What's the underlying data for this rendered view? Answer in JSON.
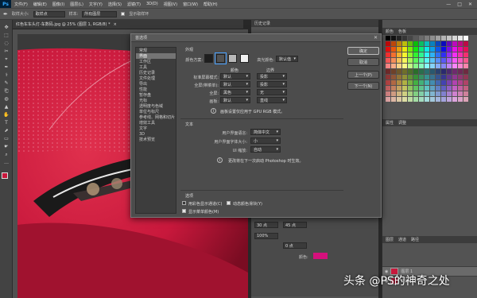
{
  "app": {
    "logo": "Ps",
    "menus": [
      "文件(F)",
      "编辑(E)",
      "图像(I)",
      "图层(L)",
      "文字(Y)",
      "选择(S)",
      "滤镜(T)",
      "3D(D)",
      "视图(V)",
      "窗口(W)",
      "帮助(H)"
    ],
    "win_min": "—",
    "win_max": "□",
    "win_close": "✕"
  },
  "options": {
    "field1_label": "取样大小:",
    "field1_value": "取样点",
    "field2_label": "样本:",
    "field2_value": "所有图层",
    "show_ring": "显示取样环"
  },
  "document": {
    "tab": "红色车车头灯-车数码.jpg @ 25% (图层 1, RGB/8) *",
    "close": "×"
  },
  "panels": {
    "right_tabs": [
      "颜色",
      "色板"
    ],
    "history_tab": "历史记录",
    "props_tabs": [
      "属性",
      "调整"
    ],
    "layer_tabs": [
      "图层",
      "通道",
      "路径"
    ],
    "layers": [
      {
        "name": "图层 1"
      },
      {
        "name": "背景"
      }
    ],
    "mid_numbers": [
      "30 点",
      "45 点",
      "100%",
      "0 点"
    ],
    "mid_color_label": "颜色:"
  },
  "dialog": {
    "title": "首选项",
    "close": "✕",
    "sidebar": [
      "常规",
      "界面",
      "工作区",
      "工具",
      "历史记录",
      "文件处理",
      "导出",
      "性能",
      "暂存盘",
      "光标",
      "透明度与色域",
      "单位与标尺",
      "参考线、网格和切片",
      "增效工具",
      "文字",
      "3D",
      "技术预览"
    ],
    "selected_index": 1,
    "appearance": {
      "heading": "外观",
      "color_scheme_label": "颜色方案:",
      "highlight_label": "高光颜色:",
      "highlight_value": "默认值",
      "col_color": "颜色",
      "col_border": "边界",
      "rows": [
        {
          "label": "标准屏幕模式:",
          "color": "默认",
          "border": "投影"
        },
        {
          "label": "全屏(带菜单):",
          "color": "默认",
          "border": "投影"
        },
        {
          "label": "全屏:",
          "color": "黑色",
          "border": "无"
        },
        {
          "label": "画板:",
          "color": "默认",
          "border": "直线"
        }
      ],
      "info": "画板设置仅应用于 GPU RGB 模式。"
    },
    "text": {
      "heading": "文本",
      "lang_label": "用户界面语言:",
      "lang_value": "简体中文",
      "size_label": "用户界面字体大小:",
      "size_value": "小",
      "scale_label": "UI 缩放:",
      "scale_value": "自动",
      "info": "更改将在下一次启动 Photoshop 时生效。"
    },
    "options": {
      "heading": "选项",
      "o1": "用彩色显示通道(C)",
      "o2": "动态颜色滑块(Y)",
      "o3": "显示菜单颜色(M)",
      "o1_checked": false,
      "o2_checked": true,
      "o3_checked": true
    },
    "buttons": [
      "确定",
      "取消",
      "上一个(P)",
      "下一个(N)"
    ]
  },
  "watermark": "头条 @PS的神奇之处",
  "colors": {
    "dialog_bg": "#4c4c4c",
    "fg_swatch": "#c8183c",
    "car_red": "#c8183c"
  }
}
